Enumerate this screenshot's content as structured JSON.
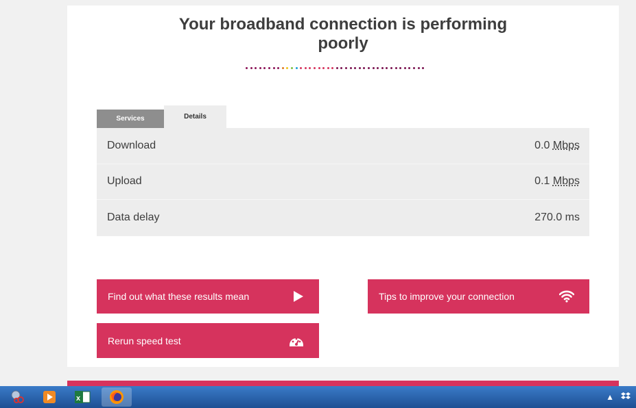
{
  "heading": {
    "line1": "Your broadband connection is performing",
    "line2": "poorly"
  },
  "tabs": [
    {
      "label": "Services"
    },
    {
      "label": "Details"
    }
  ],
  "results": [
    {
      "label": "Download",
      "value": "0.0",
      "unit": "Mbps"
    },
    {
      "label": "Upload",
      "value": "0.1",
      "unit": "Mbps"
    },
    {
      "label": "Data delay",
      "value": "270.0 ms",
      "unit": ""
    }
  ],
  "buttons": {
    "results_meaning": "Find out what these results mean",
    "tips": "Tips to improve your connection",
    "rerun": "Rerun speed test"
  },
  "colors": {
    "accent": "#d6335d",
    "dots": "#8b1457",
    "tab_inactive": "#8e8e8e",
    "panel": "#ededed"
  },
  "icons": {
    "results_button": "play-icon",
    "tips_button": "wifi-icon",
    "rerun_button": "speedometer-icon",
    "taskbar": [
      "snipping-tool-icon",
      "media-player-icon",
      "excel-icon",
      "firefox-icon"
    ],
    "tray": [
      "show-hidden-icons-arrow",
      "dropbox-icon"
    ]
  }
}
